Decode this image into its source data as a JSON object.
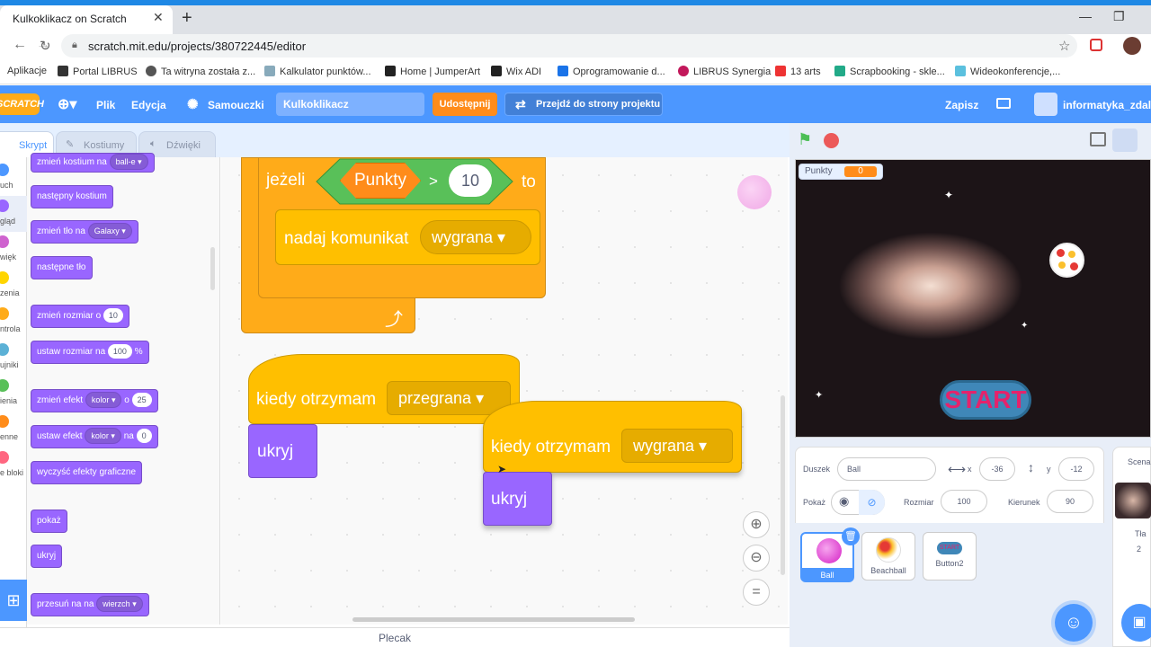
{
  "browser": {
    "tab_title": "Kulkoklikacz on Scratch",
    "url": "scratch.mit.edu/projects/380722445/editor"
  },
  "bookmarks": [
    "Aplikacje",
    "Portal LIBRUS",
    "Ta witryna została z...",
    "Kalkulator punktów...",
    "Home | JumperArt",
    "Wix ADI",
    "Oprogramowanie d...",
    "LIBRUS Synergia",
    "13 arts",
    "Scrapbooking - skle...",
    "Wideokonferencje,..."
  ],
  "menu": {
    "logo": "SCRATCH",
    "file": "Plik",
    "edit": "Edycja",
    "tutorials": "Samouczki",
    "project_title": "Kulkoklikacz",
    "share": "Udostępnij",
    "see_project": "Przejdź do strony projektu",
    "save": "Zapisz",
    "username": "informatyka_zdalnie"
  },
  "tabs": {
    "code": "Skrypt",
    "costumes": "Kostiumy",
    "sounds": "Dźwięki"
  },
  "categories": [
    "uch",
    "gląd",
    "więk",
    "zenia",
    "ntrola",
    "ujniki",
    "ienia",
    "enne",
    "e bloki"
  ],
  "palette": {
    "switch_costume": "zmień kostium na",
    "switch_costume_val": "ball-e",
    "next_costume": "następny kostium",
    "switch_backdrop": "zmień tło na",
    "switch_backdrop_val": "Galaxy",
    "next_backdrop": "następne tło",
    "change_size": "zmień rozmiar o",
    "change_size_val": "10",
    "set_size": "ustaw rozmiar na",
    "set_size_val": "100",
    "set_size_unit": "%",
    "change_effect": "zmień efekt",
    "change_effect_dd": "kolor",
    "change_effect_o": "o",
    "change_effect_val": "25",
    "set_effect": "ustaw efekt",
    "set_effect_dd": "kolor",
    "set_effect_na": "na",
    "set_effect_val": "0",
    "clear_effects": "wyczyść efekty graficzne",
    "show": "pokaż",
    "hide": "ukryj",
    "go_to_layer": "przesuń na na",
    "go_to_layer_val": "wierzch"
  },
  "scripts": {
    "if_label": "jeżeli",
    "var": "Punkty",
    "op": ">",
    "num": "10",
    "then": "to",
    "broadcast": "nadaj komunikat",
    "broadcast_val": "wygrana",
    "when_received": "kiedy otrzymam",
    "lose": "przegrana",
    "win": "wygrana",
    "hide": "ukryj"
  },
  "stage": {
    "var_label": "Punkty",
    "var_value": "0",
    "start": "START"
  },
  "sprite_info": {
    "sprite_label": "Duszek",
    "sprite_name": "Ball",
    "x_label": "x",
    "x_val": "-36",
    "y_label": "y",
    "y_val": "-12",
    "show_label": "Pokaż",
    "size_label": "Rozmiar",
    "size_val": "100",
    "dir_label": "Kierunek",
    "dir_val": "90"
  },
  "sprites": [
    "Ball",
    "Beachball",
    "Button2"
  ],
  "scene": {
    "label": "Scena",
    "backdrops_label": "Tła",
    "backdrops_count": "2"
  },
  "backpack": "Plecak"
}
